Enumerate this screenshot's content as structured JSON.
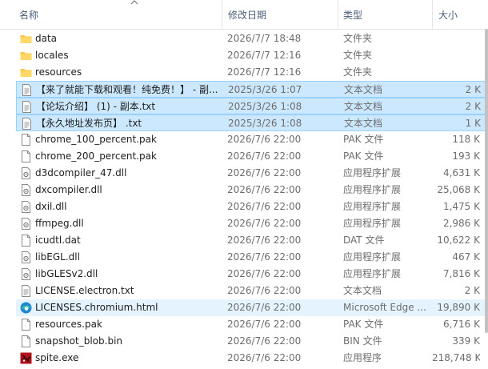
{
  "columns": {
    "name": "名称",
    "date": "修改日期",
    "type": "类型",
    "size": "大小"
  },
  "files": [
    {
      "name": "data",
      "date": "2026/7/7 18:48",
      "type": "文件夹",
      "size": "",
      "icon": "folder-icon",
      "state": "normal"
    },
    {
      "name": "locales",
      "date": "2026/7/7 12:16",
      "type": "文件夹",
      "size": "",
      "icon": "folder-icon",
      "state": "normal"
    },
    {
      "name": "resources",
      "date": "2026/7/7 12:16",
      "type": "文件夹",
      "size": "",
      "icon": "folder-icon",
      "state": "normal"
    },
    {
      "name": "【来了就能下载和观看！纯免费！】 - 副...",
      "date": "2025/3/26 1:07",
      "type": "文本文档",
      "size": "2 K",
      "icon": "text-file-icon",
      "state": "selected"
    },
    {
      "name": "【论坛介绍】 (1) - 副本.txt",
      "date": "2025/3/26 1:08",
      "type": "文本文档",
      "size": "2 K",
      "icon": "text-file-icon",
      "state": "selected"
    },
    {
      "name": "【永久地址发布页】 .txt",
      "date": "2025/3/26 1:08",
      "type": "文本文档",
      "size": "1 K",
      "icon": "text-file-icon",
      "state": "selected"
    },
    {
      "name": "chrome_100_percent.pak",
      "date": "2026/7/6 22:00",
      "type": "PAK 文件",
      "size": "118 K",
      "icon": "file-icon",
      "state": "normal"
    },
    {
      "name": "chrome_200_percent.pak",
      "date": "2026/7/6 22:00",
      "type": "PAK 文件",
      "size": "193 K",
      "icon": "file-icon",
      "state": "normal"
    },
    {
      "name": "d3dcompiler_47.dll",
      "date": "2026/7/6 22:00",
      "type": "应用程序扩展",
      "size": "4,631 K",
      "icon": "dll-file-icon",
      "state": "normal"
    },
    {
      "name": "dxcompiler.dll",
      "date": "2026/7/6 22:00",
      "type": "应用程序扩展",
      "size": "25,068 K",
      "icon": "dll-file-icon",
      "state": "normal"
    },
    {
      "name": "dxil.dll",
      "date": "2026/7/6 22:00",
      "type": "应用程序扩展",
      "size": "1,475 K",
      "icon": "dll-file-icon",
      "state": "normal"
    },
    {
      "name": "ffmpeg.dll",
      "date": "2026/7/6 22:00",
      "type": "应用程序扩展",
      "size": "2,986 K",
      "icon": "dll-file-icon",
      "state": "normal"
    },
    {
      "name": "icudtl.dat",
      "date": "2026/7/6 22:00",
      "type": "DAT 文件",
      "size": "10,622 K",
      "icon": "file-icon",
      "state": "normal"
    },
    {
      "name": "libEGL.dll",
      "date": "2026/7/6 22:00",
      "type": "应用程序扩展",
      "size": "467 K",
      "icon": "dll-file-icon",
      "state": "normal"
    },
    {
      "name": "libGLESv2.dll",
      "date": "2026/7/6 22:00",
      "type": "应用程序扩展",
      "size": "7,816 K",
      "icon": "dll-file-icon",
      "state": "normal"
    },
    {
      "name": "LICENSE.electron.txt",
      "date": "2026/7/6 22:00",
      "type": "文本文档",
      "size": "2 K",
      "icon": "text-file-icon",
      "state": "normal"
    },
    {
      "name": "LICENSES.chromium.html",
      "date": "2026/7/6 22:00",
      "type": "Microsoft Edge ...",
      "size": "19,890 K",
      "icon": "edge-html-icon",
      "state": "hover"
    },
    {
      "name": "resources.pak",
      "date": "2026/7/6 22:00",
      "type": "PAK 文件",
      "size": "6,716 K",
      "icon": "file-icon",
      "state": "normal"
    },
    {
      "name": "snapshot_blob.bin",
      "date": "2026/7/6 22:00",
      "type": "BIN 文件",
      "size": "339 K",
      "icon": "file-icon",
      "state": "normal"
    },
    {
      "name": "spite.exe",
      "date": "2026/7/6 22:00",
      "type": "应用程序",
      "size": "218,748 K",
      "icon": "app-exe-icon",
      "state": "normal"
    }
  ],
  "colors": {
    "selected_bg": "#cce8ff",
    "selected_border": "#99d1ff",
    "hover_bg": "#e5f3ff",
    "folder": "#f8c94a",
    "header_text": "#4c607a"
  }
}
